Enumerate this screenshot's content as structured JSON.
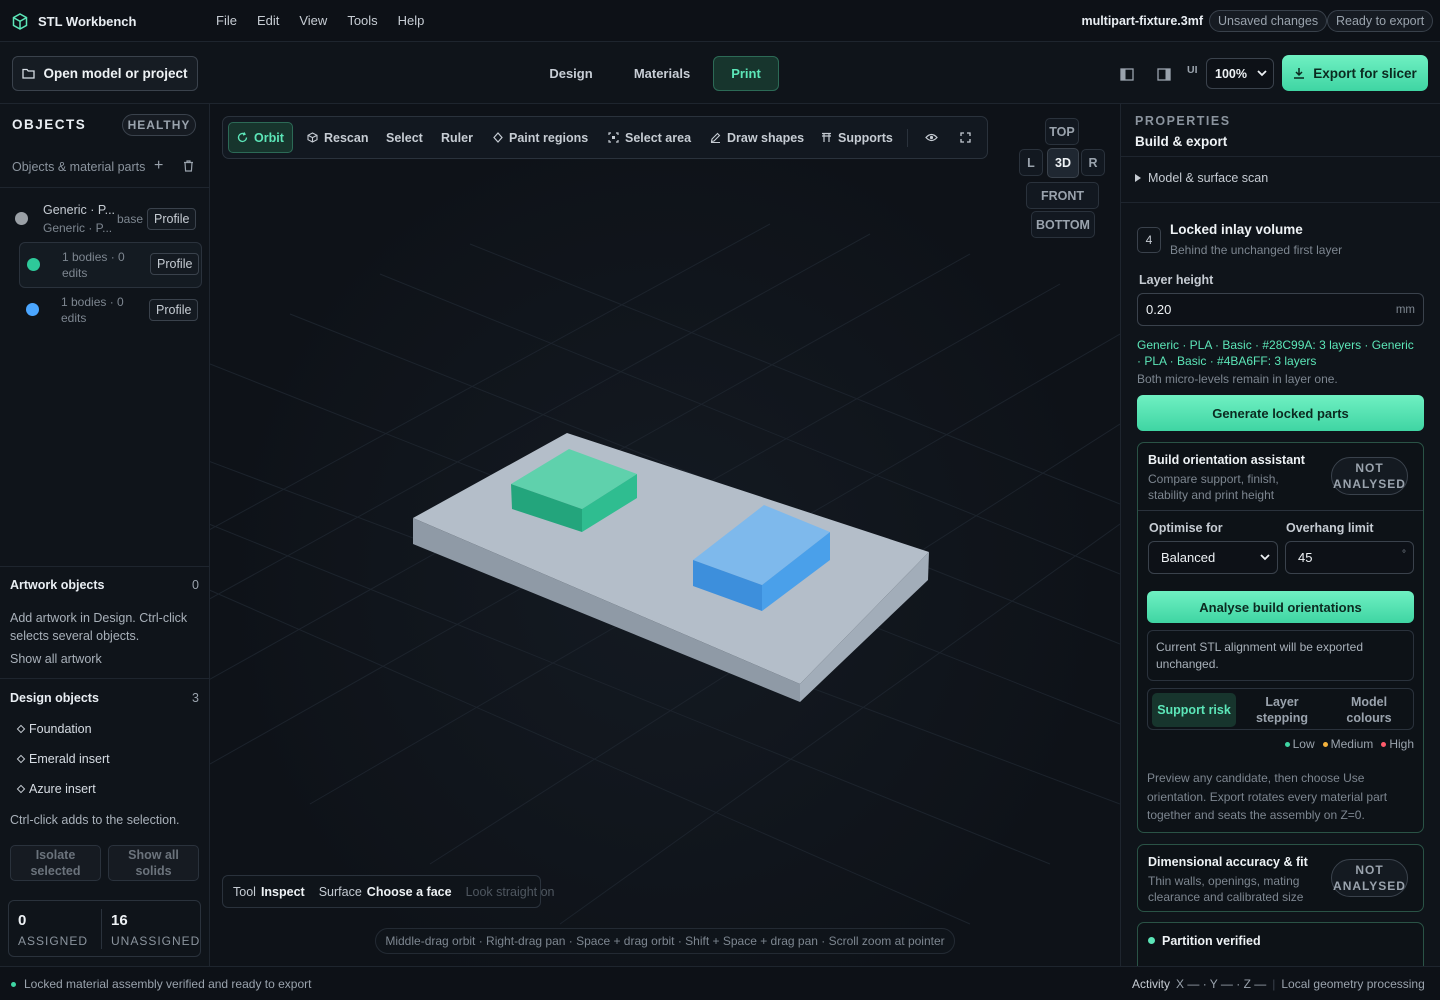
{
  "app": {
    "name": "STL Workbench",
    "menu": [
      "File",
      "Edit",
      "View",
      "Tools",
      "Help"
    ],
    "filename": "multipart-fixture.3mf",
    "chip_unsaved": "Unsaved changes",
    "chip_ready": "Ready to export"
  },
  "toolbar": {
    "open_label": "Open model or project",
    "tabs": [
      "Design",
      "Materials",
      "Print"
    ],
    "active_tab": "Print",
    "ui_label": "UI",
    "zoom": "100%",
    "export_label": "Export for slicer"
  },
  "objects": {
    "title": "OBJECTS",
    "health": "HEALTHY",
    "subtitle": "Objects & material parts",
    "rows": [
      {
        "line1": "Generic · P...",
        "line2": "Generic · P...",
        "tag": "base",
        "profile": "Profile",
        "color": "#9aa0a6"
      },
      {
        "line1": "1 bodies · 0",
        "line2": "edits",
        "profile": "Profile",
        "color": "#2ec99a"
      },
      {
        "line1": "1 bodies · 0",
        "line2": "edits",
        "profile": "Profile",
        "color": "#4ba6ff"
      }
    ]
  },
  "artwork": {
    "title": "Artwork objects",
    "count": "0",
    "help": "Add artwork in Design. Ctrl-click selects several objects.",
    "show_all": "Show all artwork"
  },
  "design_objects": {
    "title": "Design objects",
    "count": "3",
    "items": [
      "Foundation",
      "Emerald insert",
      "Azure insert"
    ],
    "hint": "Ctrl-click adds to the selection.",
    "isolate": "Isolate selected",
    "show_all": "Show all solids"
  },
  "stats": {
    "assigned_value": "0",
    "assigned_label": "ASSIGNED",
    "unassigned_value": "16",
    "unassigned_label": "UNASSIGNED"
  },
  "tools": {
    "items": [
      "Orbit",
      "Rescan",
      "Select",
      "Ruler",
      "Paint regions",
      "Select area",
      "Draw shapes",
      "Supports"
    ],
    "active": "Orbit"
  },
  "views": {
    "top": "TOP",
    "left": "L",
    "three_d": "3D",
    "right": "R",
    "front": "FRONT",
    "bottom": "BOTTOM",
    "active": "3D"
  },
  "inspect": {
    "tool_label": "Tool",
    "tool_value": "Inspect",
    "surface_label": "Surface",
    "surface_value": "Choose a face",
    "extra": "Look straight on"
  },
  "hint": "Middle-drag orbit · Right-drag pan · Space + drag orbit · Shift + Space + drag pan · Scroll zoom at pointer",
  "colors": {
    "accent": "#5ce6b8",
    "foundation": "#aeb8c4",
    "emerald": "#2ec99a",
    "azure": "#4ba6ff",
    "risk_low": "#3fd5a3",
    "risk_medium": "#f2b13c",
    "risk_high": "#ff5b6b"
  },
  "properties": {
    "kicker": "PROPERTIES",
    "title": "Build & export",
    "scan_toggle": "Model & surface scan",
    "step": "4",
    "inlay_title": "Locked inlay volume",
    "inlay_sub": "Behind the unchanged first layer",
    "layer_height_label": "Layer height",
    "layer_height_value": "0.20",
    "layer_height_unit": "mm",
    "layers_text": "Generic · PLA · Basic · #28C99A: 3 layers · Generic · PLA · Basic · #4BA6FF: 3 layers",
    "layers_note": "Both micro-levels remain in layer one.",
    "generate_label": "Generate locked parts"
  },
  "orientation": {
    "title": "Build orientation assistant",
    "sub": "Compare support, finish, stability and print height",
    "badge": "NOT ANALYSED",
    "optimise_label": "Optimise for",
    "optimise_value": "Balanced",
    "overhang_label": "Overhang limit",
    "overhang_value": "45",
    "overhang_unit": "°",
    "analyse_label": "Analyse build orientations",
    "alignment_note": "Current STL alignment will be exported unchanged.",
    "segments": [
      "Support risk",
      "Layer stepping",
      "Model colours"
    ],
    "active_segment": "Support risk",
    "legend": [
      "Low",
      "Medium",
      "High"
    ],
    "preview_text": "Preview any candidate, then choose Use orientation. Export rotates every material part together and seats the assembly on Z=0."
  },
  "dimensional": {
    "title": "Dimensional accuracy & fit",
    "sub": "Thin walls, openings, mating clearance and calibrated size",
    "badge": "NOT ANALYSED"
  },
  "partition": {
    "title": "Partition verified"
  },
  "status": {
    "left": "Locked material assembly verified and ready to export",
    "activity": "Activity",
    "coords": "X — · Y — · Z —",
    "processing": "Local geometry processing"
  }
}
